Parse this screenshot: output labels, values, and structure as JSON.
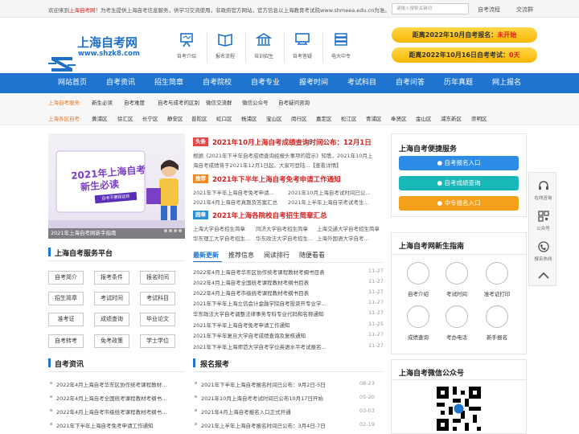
{
  "topbar": {
    "notice_prefix": "欢迎来到",
    "site_name": "上海自考网",
    "notice_rest": "！为考生提供上海自考信息服务，供学习交流使用，非政府官方网站，官方信息以上海教育考试院www.shmeea.edu.cn为准。",
    "search_placeholder": "请输入搜索关键词",
    "links": [
      "自考流程",
      "交流群"
    ]
  },
  "logo": {
    "name": "上海自考网",
    "url": "www.shzk8.com"
  },
  "header_icons": [
    {
      "label": "自考介绍",
      "icon": "easel-icon"
    },
    {
      "label": "报名流程",
      "icon": "book-icon"
    },
    {
      "label": "培训招生",
      "icon": "building-icon"
    },
    {
      "label": "自考答疑",
      "icon": "classroom-icon"
    },
    {
      "label": "电大中专",
      "icon": "stack-icon"
    }
  ],
  "countdowns": [
    {
      "text": "距离2022年10月自考报名：",
      "value": "未开始"
    },
    {
      "text": "距离2022年10月16日自考考试：",
      "value": "0天"
    }
  ],
  "nav": [
    "网站首页",
    "自考资讯",
    "招生简章",
    "自考院校",
    "自考专业",
    "报考时间",
    "考试科目",
    "自考问答",
    "历年真题",
    "网上报名"
  ],
  "subnav": {
    "service_label": "上海自考服务:",
    "service_items": [
      "新生必读",
      "自考难度",
      "自考与成考的区别",
      "微信交流群",
      "微信公众号",
      "自考疑问咨询"
    ],
    "district_label": "上海各区自考:",
    "district_items": [
      "黄浦区",
      "徐汇区",
      "长宁区",
      "静安区",
      "普陀区",
      "虹口区",
      "杨浦区",
      "宝山区",
      "闵行区",
      "嘉定区",
      "松江区",
      "青浦区",
      "奉贤区",
      "金山区",
      "浦东新区",
      "崇明区"
    ]
  },
  "slider": {
    "line1": "2021年上海自考",
    "line2": "新生必读",
    "badge": "自考不要踩这些",
    "caption": "2021年上海自考网新手指南"
  },
  "headlines": [
    {
      "tag": "头条",
      "title": "2021年10月上海自考成绩查询时间公布：12月1日",
      "desc1": "根据《2021年下半年自考成绩查询经报头事项的提示》知悉，2021年10月上",
      "desc2": "海自考成绩将于2021年12月1日起，大家可登陆...【查看详情】",
      "links": []
    },
    {
      "tag": "推荐",
      "title": "2021年下半年上海自考免考申请工作通知",
      "links": [
        "2021年下半年上海自考免考申请...",
        "2021年10月上海自考试时间已公...",
        "2021年4月上海自考真题及答案汇总",
        "2021年上半年上海自学考试考生..."
      ]
    },
    {
      "tag": "园章",
      "title": "2021年上海各院校自考招生简章汇总",
      "links": [
        "上海大学自考招生简章",
        "同济大学自考招生简章",
        "上海交通大学自考招生简章",
        "华东理工大学自考招生...",
        "华东政法大学自考招生...",
        "上海外国语大学自考..."
      ]
    }
  ],
  "tabs": [
    "最新更新",
    "推荐信息",
    "阅读排行",
    "随便看看"
  ],
  "latest": [
    {
      "t": "2022年4月上海自考华东区协作统考课程教材考纲书目表",
      "d": "11-27"
    },
    {
      "t": "2022年4月上海自考全国统考课程教材考纲书目表",
      "d": "11-27"
    },
    {
      "t": "2022年4月上海自考市级统考课程教材考纲书目表",
      "d": "11-27"
    },
    {
      "t": "2021年下半年上海立信会计金融学院自考投资开专业学...",
      "d": "11-27"
    },
    {
      "t": "华东政法大学自考调整法律事务专科专业代码和名称通知",
      "d": "11-27"
    },
    {
      "t": "2021年下半年上海自考免考申请工作通知",
      "d": "11-25"
    },
    {
      "t": "2021年下半年复旦大学自考成绩查询及复核通知",
      "d": "11-27"
    },
    {
      "t": "2021年下半年上海师范大学自考学位英语水平考试报名...",
      "d": "11-27"
    }
  ],
  "service_platform": {
    "title": "上海自考服务平台",
    "buttons": [
      "自考简介",
      "报考条件",
      "报名时间",
      "招生简章",
      "考试时间",
      "考试科目",
      "准考证",
      "成绩查询",
      "毕业论文",
      "自考转考",
      "免考政策",
      "学士学位"
    ]
  },
  "news_left": {
    "title": "自考资讯",
    "items": [
      {
        "t": "2022年4月上海自考华东区协作统考课程教材...",
        "d": "11-27"
      },
      {
        "t": "2022年4月上海自考全国统考课程教材考纲书...",
        "d": "11-27"
      },
      {
        "t": "2022年4月上海自考市级统考课程教材考纲书...",
        "d": "11-27"
      },
      {
        "t": "2021年下半年上海自考免考申请工作通知",
        "d": "11-25"
      }
    ]
  },
  "news_mid": {
    "title": "报名报考",
    "items": [
      {
        "t": "2021年下半年上海自考报名时间已公布：9月2日-5日",
        "d": "08-23"
      },
      {
        "t": "2021年10月上海自考考试时间已公布10月17日开始",
        "d": "05-20"
      },
      {
        "t": "2021年4月上海自考报名入口正式开通",
        "d": "03-03"
      },
      {
        "t": "2021年上半年上海自考报名时间已公布：3月4日-7日",
        "d": "02-19"
      }
    ]
  },
  "convenience": {
    "title": "上海自考便捷服务",
    "buttons": [
      {
        "label": "自考报名入口",
        "color": "#2d8ce6"
      },
      {
        "label": "自考成绩查询",
        "color": "#19b8b8"
      },
      {
        "label": "中专报名入口",
        "color": "#f5a01a"
      }
    ]
  },
  "guide": {
    "title": "上海自考网新生指南",
    "items": [
      {
        "label": "自考介绍",
        "icon": "person-icon"
      },
      {
        "label": "考试时间",
        "icon": "clock-icon"
      },
      {
        "label": "准考证打印",
        "icon": "card-icon"
      },
      {
        "label": "成绩查询",
        "icon": "document-icon"
      },
      {
        "label": "考办电话",
        "icon": "phone-icon"
      },
      {
        "label": "新手报名",
        "icon": "form-icon"
      }
    ]
  },
  "wechat": {
    "title": "上海自考微信公众号"
  },
  "side": [
    "在线咨询",
    "公众号",
    "报名热线"
  ]
}
